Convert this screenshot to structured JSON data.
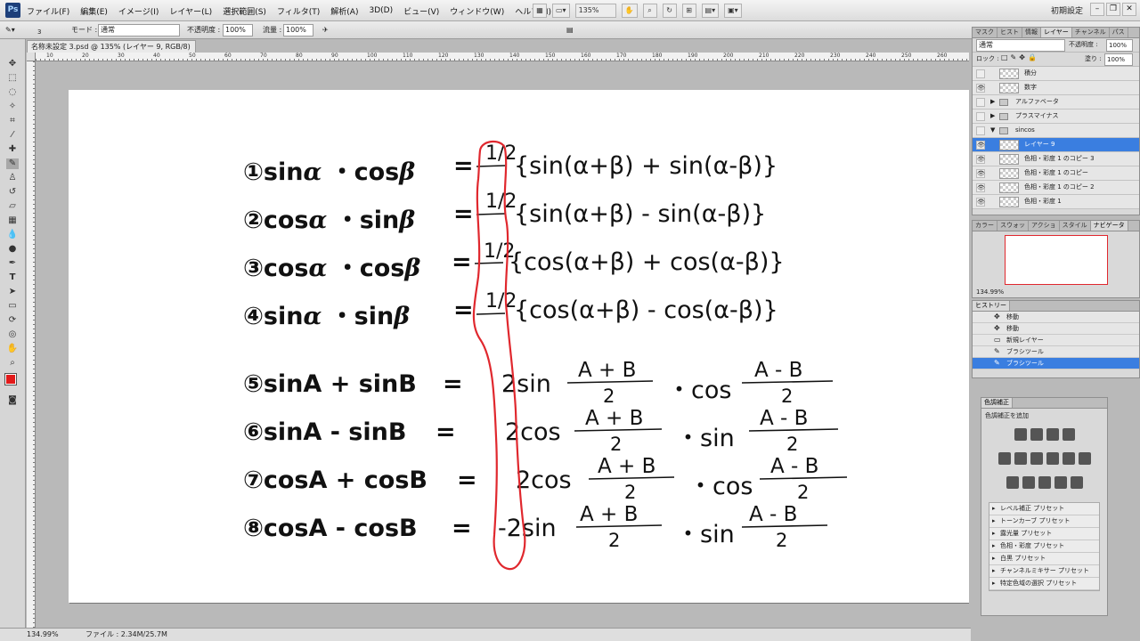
{
  "menu": {
    "logo": "Ps",
    "items": [
      "ファイル(F)",
      "編集(E)",
      "イメージ(I)",
      "レイヤー(L)",
      "選択範囲(S)",
      "フィルタ(T)",
      "解析(A)",
      "3D(D)",
      "ビュー(V)",
      "ウィンドウ(W)",
      "ヘルプ(H)"
    ],
    "zoom": "135%",
    "workspace": "初期設定"
  },
  "options": {
    "brush_size": "3",
    "mode_label": "モード :",
    "mode_value": "通常",
    "opacity_label": "不透明度 :",
    "opacity_value": "100%",
    "flow_label": "流量 :",
    "flow_value": "100%"
  },
  "document": {
    "tab_title": "名称未設定 3.psd @ 135% (レイヤー 9, RGB/8) *",
    "ruler_numbers": [
      "10",
      "20",
      "30",
      "40",
      "50",
      "60",
      "70",
      "80",
      "90",
      "100",
      "110",
      "120",
      "130",
      "140",
      "150",
      "160",
      "170",
      "180",
      "190",
      "200",
      "210",
      "220",
      "230",
      "240",
      "250",
      "260"
    ]
  },
  "formulas": [
    {
      "num": "①",
      "lhs1": "sin",
      "g1": "α",
      "op": "・",
      "lhs2": "cos",
      "g2": "β",
      "eq": "=",
      "frac": "1/2",
      "rhs": "{sin(α+β) + sin(α-β)}"
    },
    {
      "num": "②",
      "lhs1": "cos",
      "g1": "α",
      "op": "・",
      "lhs2": "sin",
      "g2": "β",
      "eq": "=",
      "frac": "1/2",
      "rhs": "{sin(α+β) - sin(α-β)}"
    },
    {
      "num": "③",
      "lhs1": "cos",
      "g1": "α",
      "op": "・",
      "lhs2": "cos",
      "g2": "β",
      "eq": "=",
      "frac": "1/2",
      "rhs": "{cos(α+β) + cos(α-β)}"
    },
    {
      "num": "④",
      "lhs1": "sin",
      "g1": "α",
      "op": "・",
      "lhs2": "sin",
      "g2": "β",
      "eq": "=",
      "frac": "1/2",
      "rhs": "{cos(α+β) - cos(α-β)}"
    }
  ],
  "sum_formulas": [
    {
      "lhs": "⑤sinA + sinB",
      "eq": "=",
      "coef": "2sin",
      "num1": "A + B",
      "den1": "2",
      "op": "・cos",
      "num2": "A - B",
      "den2": "2"
    },
    {
      "lhs": "⑥sinA - sinB",
      "eq": "=",
      "coef": "2cos",
      "num1": "A + B",
      "den1": "2",
      "op": "・sin",
      "num2": "A - B",
      "den2": "2"
    },
    {
      "lhs": "⑦cosA + cosB",
      "eq": "=",
      "coef": "2cos",
      "num1": "A + B",
      "den1": "2",
      "op": "・cos",
      "num2": "A - B",
      "den2": "2"
    },
    {
      "lhs": "⑧cosA - cosB",
      "eq": "=",
      "coef": "-2sin",
      "num1": "A + B",
      "den1": "2",
      "op": "・sin",
      "num2": "A - B",
      "den2": "2"
    }
  ],
  "status": {
    "zoom": "134.99%",
    "file": "ファイル : 2.34M/25.7M"
  },
  "layers_panel": {
    "tabs": [
      "マスク",
      "ヒスト",
      "情報",
      "レイヤー",
      "チャンネル",
      "パス"
    ],
    "blend": "通常",
    "opacity_label": "不透明度 :",
    "opacity": "100%",
    "lock_label": "ロック :",
    "fill_label": "塗り :",
    "fill": "100%",
    "layers": [
      {
        "name": "積分",
        "type": "layer",
        "visible": false
      },
      {
        "name": "数字",
        "type": "layer",
        "visible": true
      },
      {
        "name": "アルファベータ",
        "type": "group",
        "visible": false
      },
      {
        "name": "プラスマイナス",
        "type": "group",
        "visible": false
      },
      {
        "name": "sincos",
        "type": "group-open",
        "visible": false
      },
      {
        "name": "レイヤー 9",
        "type": "layer",
        "visible": true,
        "selected": true
      },
      {
        "name": "色相・彩度 1 のコピー 3",
        "type": "layer",
        "visible": true
      },
      {
        "name": "色相・彩度 1 のコピー",
        "type": "layer",
        "visible": true
      },
      {
        "name": "色相・彩度 1 のコピー 2",
        "type": "layer",
        "visible": true
      },
      {
        "name": "色相・彩度 1",
        "type": "layer",
        "visible": true
      }
    ]
  },
  "navigator_panel": {
    "tabs": [
      "カラー",
      "スウォッ",
      "アクショ",
      "スタイル",
      "ナビゲータ"
    ],
    "zoom": "134.99%"
  },
  "history_panel": {
    "title": "ヒストリー",
    "items": [
      {
        "name": "移動",
        "icon": "move"
      },
      {
        "name": "移動",
        "icon": "move"
      },
      {
        "name": "新規レイヤー",
        "icon": "layer"
      },
      {
        "name": "ブラシツール",
        "icon": "brush"
      },
      {
        "name": "ブラシツール",
        "icon": "brush",
        "selected": true
      }
    ]
  },
  "adjustments_panel": {
    "title": "色調補正",
    "subtitle": "色調補正を追加",
    "presets": [
      "レベル補正 プリセット",
      "トーンカーブ プリセット",
      "露光量 プリセット",
      "色相・彩度 プリセット",
      "白黒 プリセット",
      "チャンネルミキサー プリセット",
      "特定色域の選択 プリセット"
    ]
  },
  "colors": {
    "foreground": "#e21a1a",
    "background": "#f7b3c9",
    "selection": "#3a7ee0",
    "annotation": "#e0282e"
  }
}
